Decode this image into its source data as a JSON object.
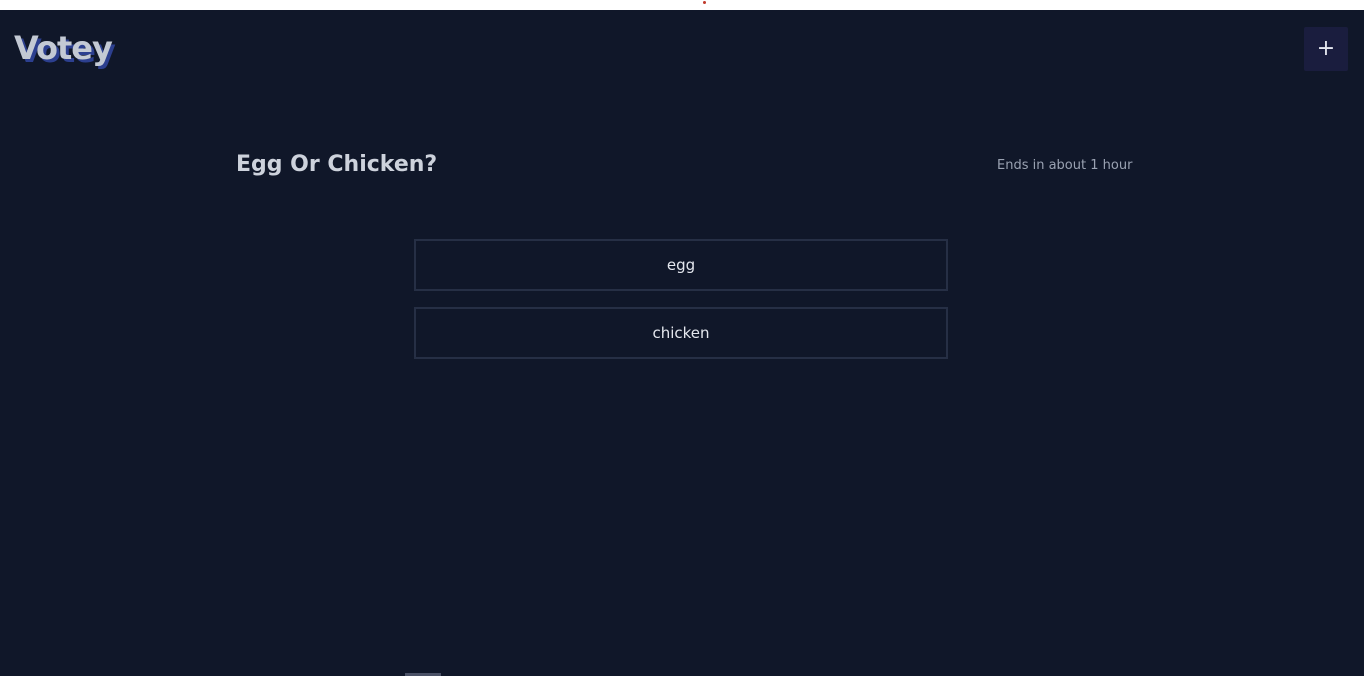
{
  "colors": {
    "background": "#101729",
    "logo_text": "#c3c9d4",
    "logo_shadow": "#2c3f8f",
    "add_button_bg": "#1a1d3e",
    "option_border": "#262f45",
    "topbar_dot": "#c0392b"
  },
  "header": {
    "logo": "Votey",
    "add_button_icon": "plus-icon",
    "add_button_label": "+"
  },
  "poll": {
    "title": "Egg Or Chicken?",
    "ends": "Ends in about 1 hour",
    "options": [
      {
        "label": "egg"
      },
      {
        "label": "chicken"
      }
    ]
  }
}
